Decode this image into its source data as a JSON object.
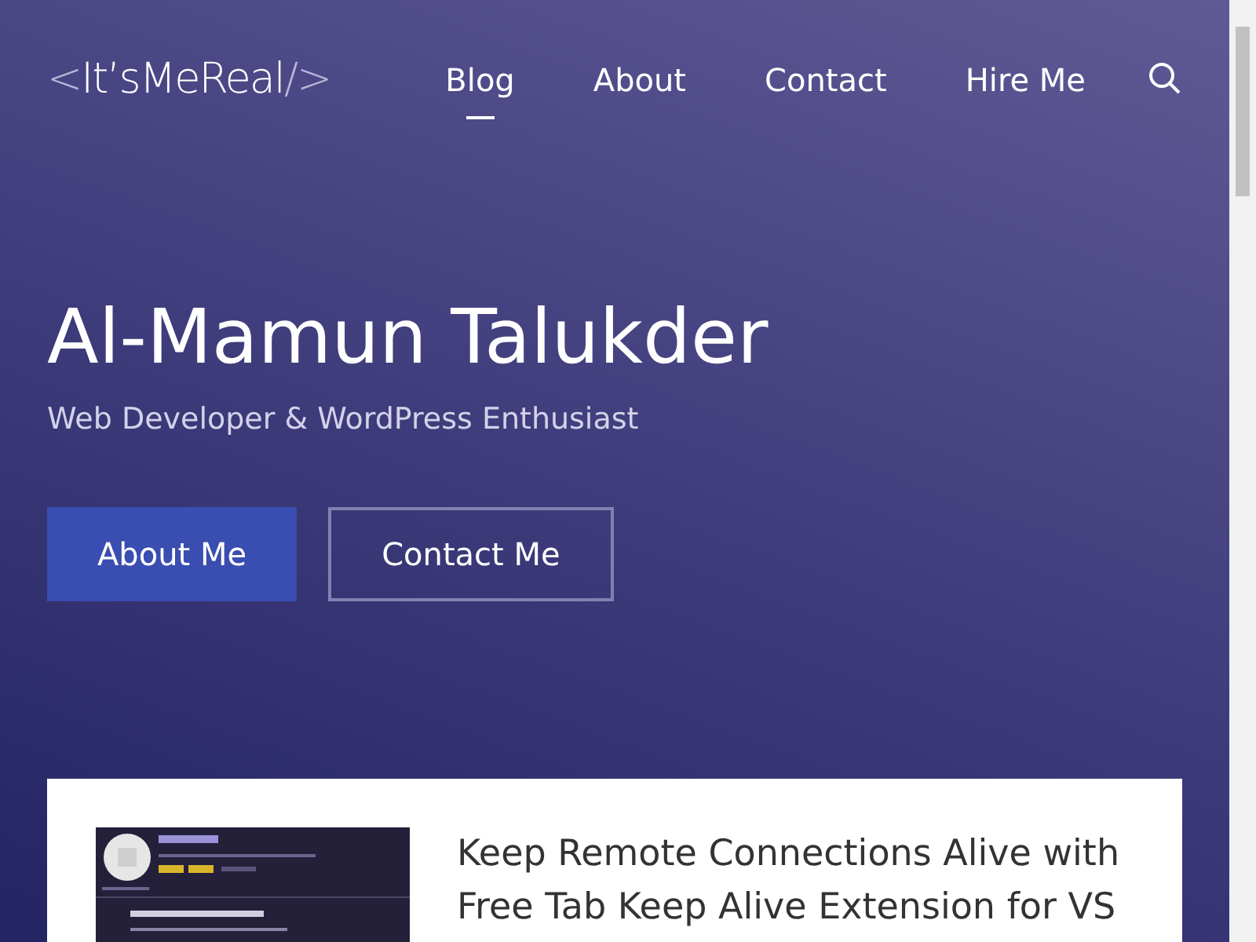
{
  "logo": {
    "open": "<",
    "name": "It’sMeReal",
    "close": "/>"
  },
  "nav": [
    {
      "label": "Blog",
      "selected": true
    },
    {
      "label": "About",
      "selected": false
    },
    {
      "label": "Contact",
      "selected": false
    },
    {
      "label": "Hire Me",
      "selected": false
    }
  ],
  "hero": {
    "title": "Al-Mamun Talukder",
    "subtitle": "Web Developer & WordPress Enthusiast",
    "buttons": [
      {
        "label": "About Me",
        "kind": "primary"
      },
      {
        "label": "Contact Me",
        "kind": "outline"
      }
    ]
  },
  "post": {
    "title": "Keep Remote Connections Alive with Free Tab Keep Alive Extension for VS"
  }
}
